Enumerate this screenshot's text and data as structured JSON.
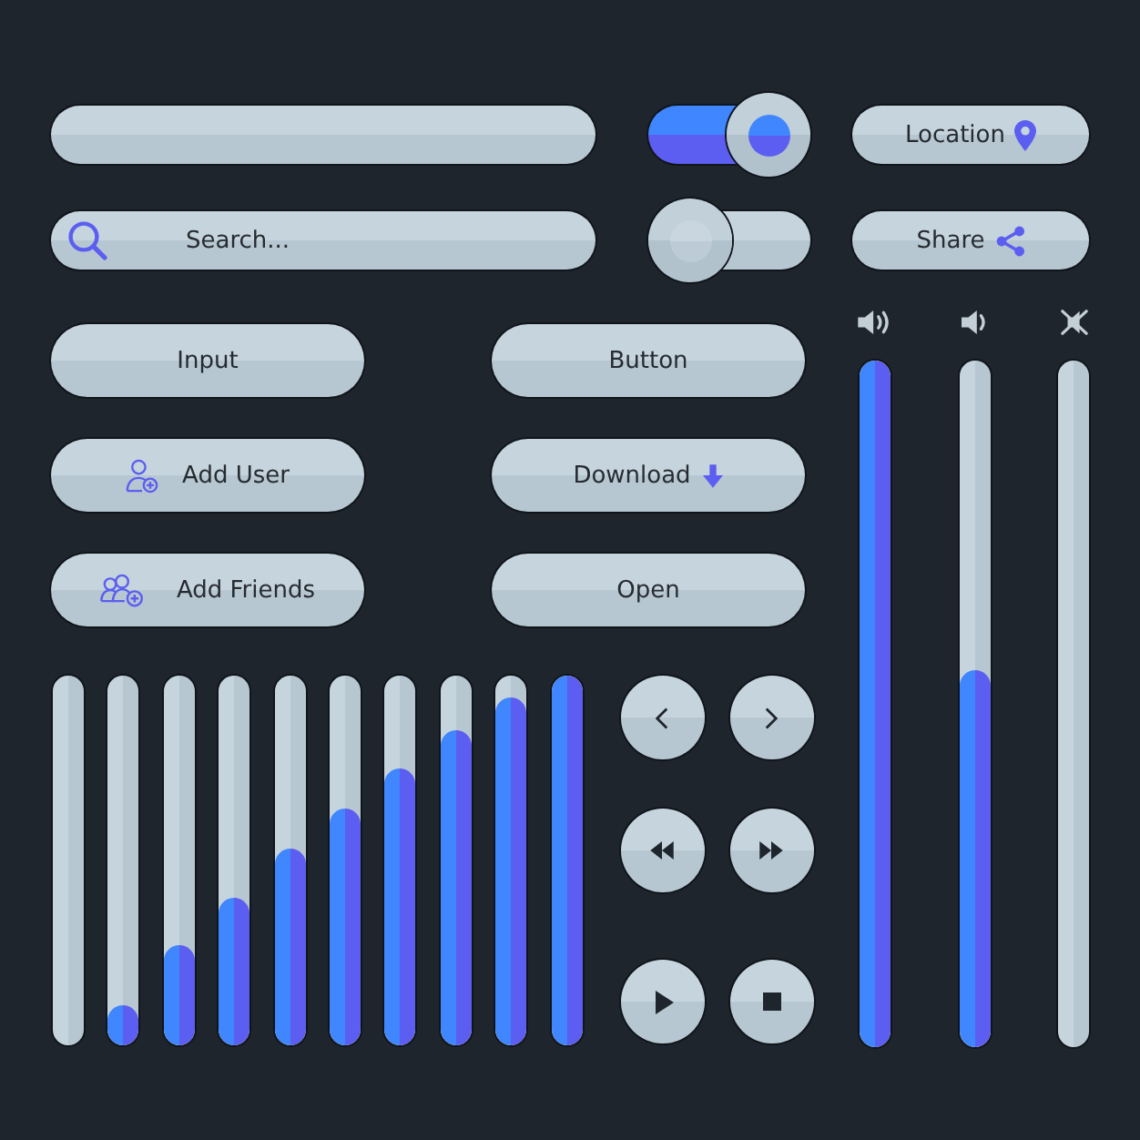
{
  "top_rows": [
    {
      "field": {
        "kind": "text"
      },
      "toggle": {
        "on": true
      },
      "button": {
        "kind": "location",
        "label": "Location"
      }
    },
    {
      "field": {
        "kind": "search",
        "placeholder": "Search..."
      },
      "toggle": {
        "on": false
      },
      "button": {
        "kind": "share",
        "label": "Share"
      }
    }
  ],
  "buttons": [
    {
      "kind": "plain",
      "label": "Input"
    },
    {
      "kind": "plain",
      "label": "Button"
    },
    {
      "kind": "add-user",
      "label": "Add User"
    },
    {
      "kind": "download",
      "label": "Download"
    },
    {
      "kind": "add-friends",
      "label": "Add Friends"
    },
    {
      "kind": "plain",
      "label": "Open"
    }
  ],
  "level_bars": [
    {
      "level": 0
    },
    {
      "level": 0.11
    },
    {
      "level": 0.27
    },
    {
      "level": 0.4
    },
    {
      "level": 0.53
    },
    {
      "level": 0.64
    },
    {
      "level": 0.75
    },
    {
      "level": 0.85
    },
    {
      "level": 0.94
    },
    {
      "level": 1
    }
  ],
  "media_controls": [
    {
      "kind": "previous"
    },
    {
      "kind": "next"
    },
    {
      "kind": "rewind"
    },
    {
      "kind": "fast-forward"
    },
    {
      "kind": "play"
    },
    {
      "kind": "stop"
    }
  ],
  "volume_sliders": [
    {
      "kind": "loud",
      "level": 1
    },
    {
      "kind": "low",
      "level": 0.55
    },
    {
      "kind": "muted",
      "level": 0
    }
  ]
}
